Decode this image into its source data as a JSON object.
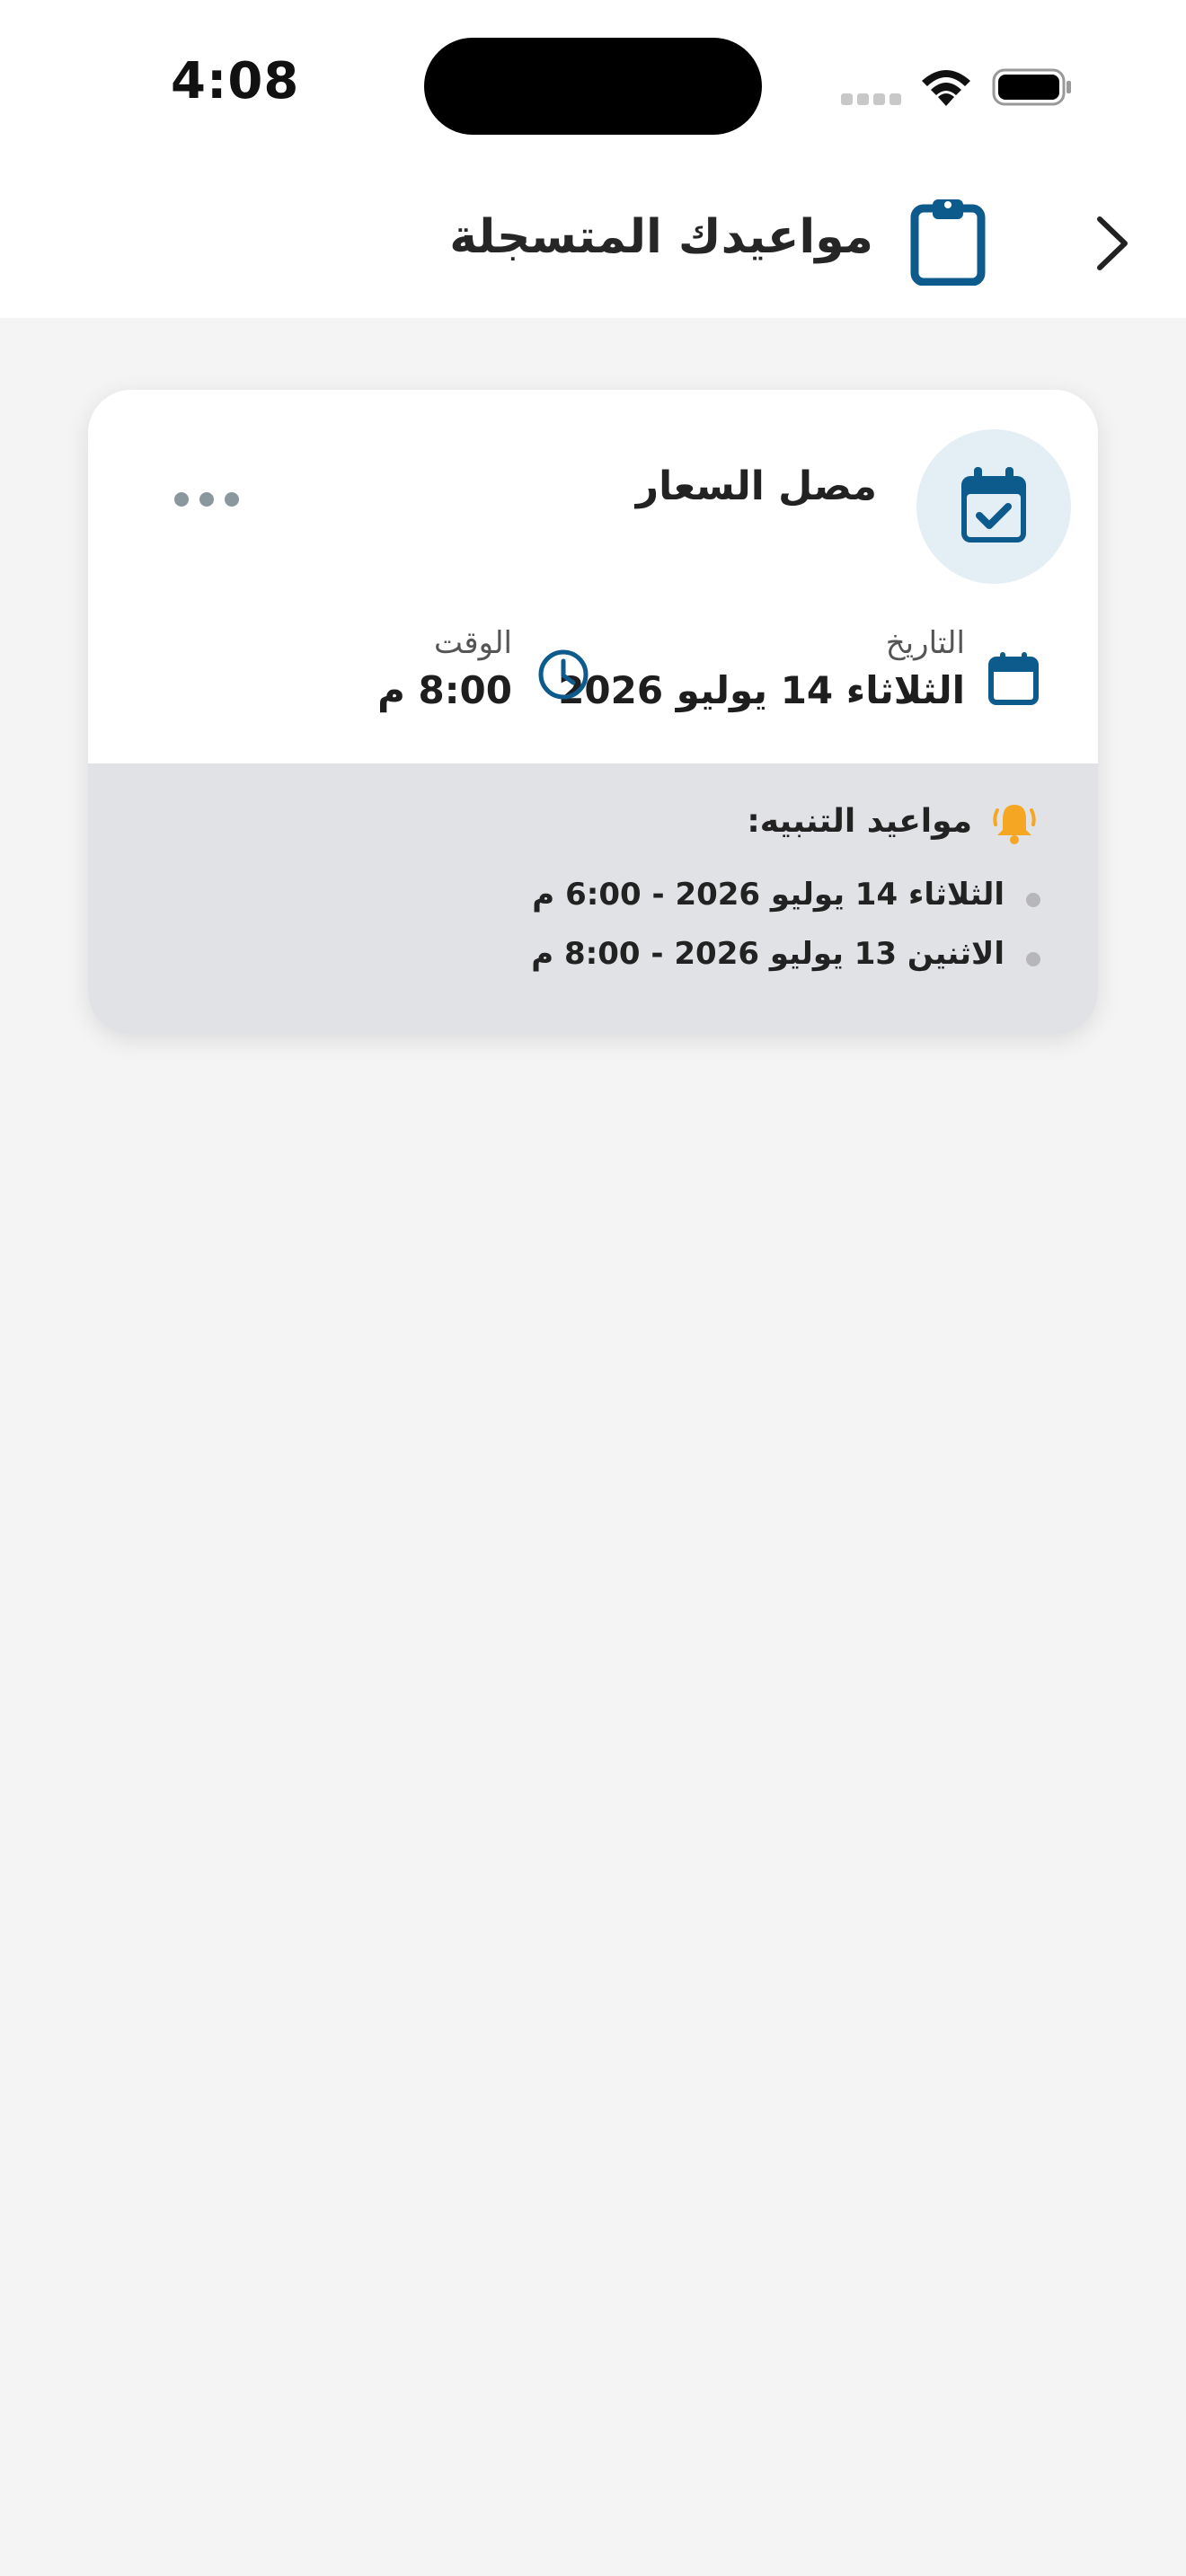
{
  "status_bar": {
    "time": "4:08"
  },
  "header": {
    "title": "مواعيدك المتسجلة"
  },
  "appointment": {
    "doctor_name": "مصل السعار",
    "date_label": "التاريخ",
    "date_value": "الثلاثاء 14 يوليو 2026",
    "time_label": "الوقت",
    "time_value": "8:00 م",
    "alerts_title": "مواعيد التنبيه:",
    "alerts": [
      "الثلاثاء 14 يوليو 2026  -  6:00 م",
      "الاثنين 13 يوليو 2026  -  8:00 م"
    ]
  },
  "colors": {
    "accent": "#0d5a8c",
    "bell": "#f5a623",
    "background": "#f4f4f4"
  }
}
